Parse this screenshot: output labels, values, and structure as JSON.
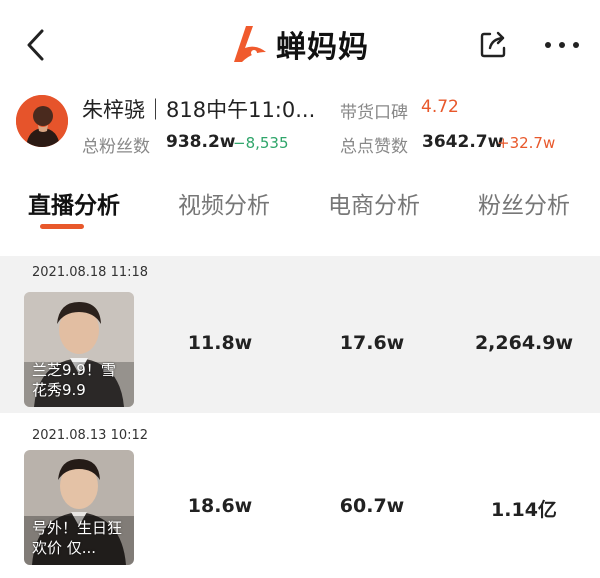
{
  "header": {
    "app_name": "蝉妈妈",
    "brand_color": "#f05a2d",
    "back_icon": "chevron-left-icon",
    "share_icon": "share-icon",
    "more_icon": "more-horizontal-icon"
  },
  "profile": {
    "name": "朱梓骁｜818中午11:0...",
    "rating_label": "带货口碑",
    "rating_value": "4.72",
    "fans_label": "总粉丝数",
    "fans_value": "938.2w",
    "fans_change": "−8,535",
    "likes_label": "总点赞数",
    "likes_value": "3642.7w",
    "likes_change": "+32.7w"
  },
  "tabs": [
    {
      "label": "直播分析",
      "active": true
    },
    {
      "label": "视频分析",
      "active": false
    },
    {
      "label": "电商分析",
      "active": false
    },
    {
      "label": "粉丝分析",
      "active": false
    }
  ],
  "live_list": [
    {
      "date": "2021.08.18 11:18",
      "title": "兰芝9.9！雪花秀9.9",
      "metric_1": "11.8w",
      "metric_2": "17.6w",
      "metric_3": "2,264.9w"
    },
    {
      "date": "2021.08.13 10:12",
      "title": "号外！生日狂欢价 仅...",
      "metric_1": "18.6w",
      "metric_2": "60.7w",
      "metric_3": "1.14亿"
    }
  ],
  "colors": {
    "accent": "#e8582b",
    "positive_green": "#2fa56a",
    "row_grey": "#f2f2f2"
  }
}
